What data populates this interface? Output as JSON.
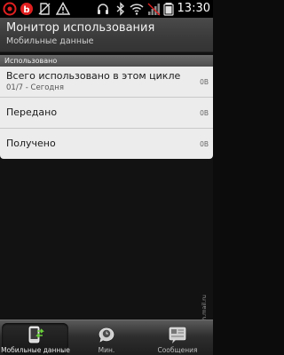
{
  "status_bar": {
    "time": "13:30",
    "icons": [
      "app-notification-icon",
      "beats-audio-icon",
      "no-sim-icon",
      "warning-icon",
      "headset-icon",
      "bluetooth-icon",
      "wifi-icon",
      "no-signal-icon",
      "battery-icon"
    ]
  },
  "header": {
    "title": "Монитор использования",
    "subtitle": "Мобильные данные"
  },
  "usage": {
    "section_label": "Использовано",
    "rows": [
      {
        "label": "Всего использовано в этом цикле",
        "sub": "01/7 - Сегодня",
        "value": "0B"
      },
      {
        "label": "Передано",
        "value": "0B"
      },
      {
        "label": "Получено",
        "value": "0B"
      }
    ]
  },
  "watermark": "© hi-tech.mail.ru",
  "tabs": [
    {
      "label": "Мобильные данные",
      "icon": "mobile-data-icon",
      "selected": true
    },
    {
      "label": "Мин.",
      "icon": "minutes-clock-icon",
      "selected": false
    },
    {
      "label": "Сообщения",
      "icon": "messages-icon",
      "selected": false
    }
  ],
  "colors": {
    "accent_red": "#e02020",
    "card_bg": "#ececec",
    "title_bg": "#3a3a3a"
  }
}
